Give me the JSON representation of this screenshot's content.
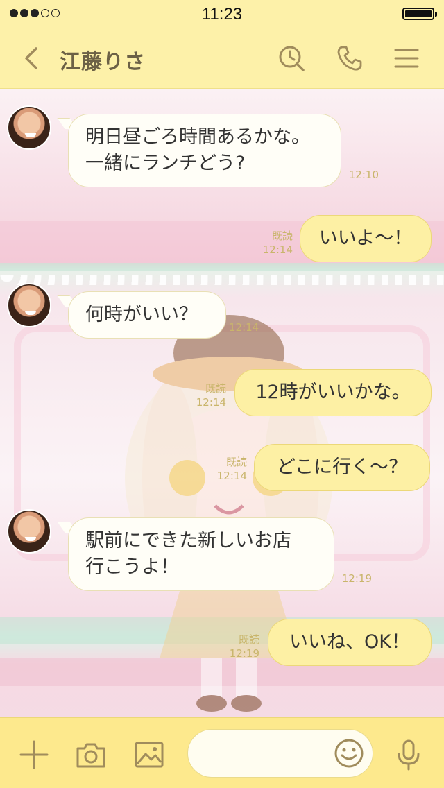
{
  "status_bar": {
    "time": "11:23",
    "signal_bars": 3,
    "signal_total": 5
  },
  "header": {
    "title": "江藤りさ",
    "icons": [
      "back-icon",
      "search-history-icon",
      "phone-icon",
      "menu-icon"
    ]
  },
  "messages": [
    {
      "side": "in",
      "lines": [
        "明日昼ごろ時間あるかな。",
        "一緒にランチどう?"
      ],
      "time": "12:10"
    },
    {
      "side": "out",
      "text": "いいよ〜！",
      "read": "既読",
      "time": "12:14"
    },
    {
      "side": "in",
      "text": "何時がいい？",
      "time": "12:14"
    },
    {
      "side": "out",
      "text": "12時がいいかな。",
      "read": "既読",
      "time": "12:14"
    },
    {
      "side": "out",
      "text": "どこに行く〜？",
      "read": "既読",
      "time": "12:14"
    },
    {
      "side": "in",
      "lines": [
        "駅前にできた新しいお店",
        "行こうよ！"
      ],
      "time": "12:19"
    },
    {
      "side": "out",
      "text": "いいね、OK！",
      "read": "既読",
      "time": "12:19"
    }
  ],
  "input_bar": {
    "text_value": "",
    "icons": [
      "plus-icon",
      "camera-icon",
      "image-icon",
      "emoji-icon",
      "microphone-icon"
    ]
  },
  "colors": {
    "header_bg": "#fdf1a9",
    "accent": "#a08c5c",
    "out_bubble": "#fdf0a4",
    "in_bubble": "#fffef7",
    "input_bar": "#fde98d"
  }
}
